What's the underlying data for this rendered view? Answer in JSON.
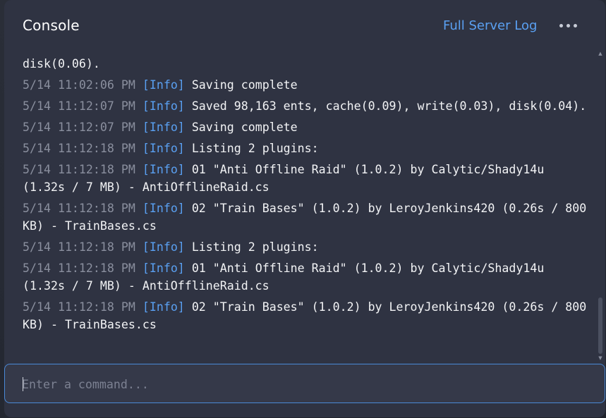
{
  "header": {
    "title": "Console",
    "full_log_label": "Full Server Log",
    "more_icon": "ellipsis-icon"
  },
  "log": {
    "entries": [
      {
        "ts": "",
        "level": "",
        "msg": "disk(0.06)."
      },
      {
        "ts": "5/14 11:02:06 PM",
        "level": "[Info]",
        "msg": "Saving complete"
      },
      {
        "ts": "5/14 11:12:07 PM",
        "level": "[Info]",
        "msg": "Saved 98,163 ents, cache(0.09), write(0.03), disk(0.04)."
      },
      {
        "ts": "5/14 11:12:07 PM",
        "level": "[Info]",
        "msg": "Saving complete"
      },
      {
        "ts": "5/14 11:12:18 PM",
        "level": "[Info]",
        "msg": "Listing 2 plugins:"
      },
      {
        "ts": "5/14 11:12:18 PM",
        "level": "[Info]",
        "msg": "01 \"Anti Offline Raid\" (1.0.2) by Calytic/Shady14u (1.32s / 7 MB) - AntiOfflineRaid.cs"
      },
      {
        "ts": "5/14 11:12:18 PM",
        "level": "[Info]",
        "msg": "02 \"Train Bases\" (1.0.2) by LeroyJenkins420 (0.26s / 800 KB) - TrainBases.cs"
      },
      {
        "ts": "5/14 11:12:18 PM",
        "level": "[Info]",
        "msg": "Listing 2 plugins:"
      },
      {
        "ts": "5/14 11:12:18 PM",
        "level": "[Info]",
        "msg": "01 \"Anti Offline Raid\" (1.0.2) by Calytic/Shady14u (1.32s / 7 MB) - AntiOfflineRaid.cs"
      },
      {
        "ts": "5/14 11:12:18 PM",
        "level": "[Info]",
        "msg": "02 \"Train Bases\" (1.0.2) by LeroyJenkins420 (0.26s / 800 KB) - TrainBases.cs"
      }
    ]
  },
  "command": {
    "placeholder": "Enter a command...",
    "value": ""
  },
  "colors": {
    "accent": "#5aa0f2",
    "panel": "#2f3342",
    "timestamp": "#8a8f9e",
    "text": "#f2f3f5"
  }
}
